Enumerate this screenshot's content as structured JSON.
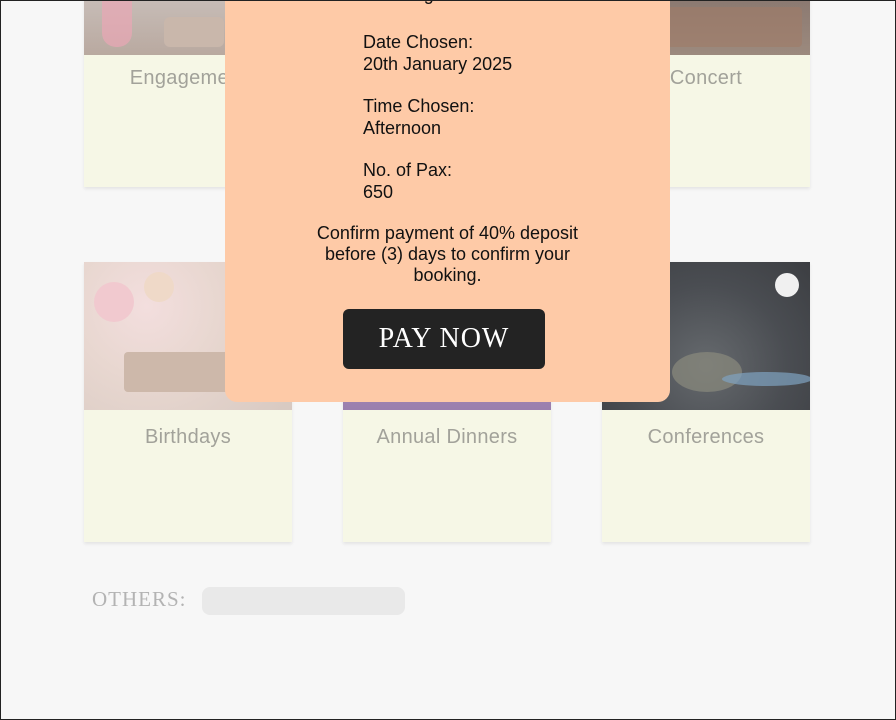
{
  "cards": {
    "engagement": "Engagement",
    "concert": "Concert",
    "birthdays": "Birthdays",
    "annual_dinners": "Annual Dinners",
    "conferences": "Conferences"
  },
  "others": {
    "label": "OTHERS:",
    "value": ""
  },
  "modal": {
    "event_type": "Wedding",
    "date_label": "Date Chosen:",
    "date_value": "20th January 2025",
    "time_label": "Time Chosen:",
    "time_value": "Afternoon",
    "pax_label": "No. of Pax:",
    "pax_value": "650",
    "confirm_text": "Confirm payment of 40% deposit before (3) days to confirm your booking.",
    "pay_button": "PAY NOW"
  },
  "colors": {
    "modal_bg": "#fecaa7",
    "card_bg": "#f6f7e6",
    "button_bg": "#232323"
  }
}
